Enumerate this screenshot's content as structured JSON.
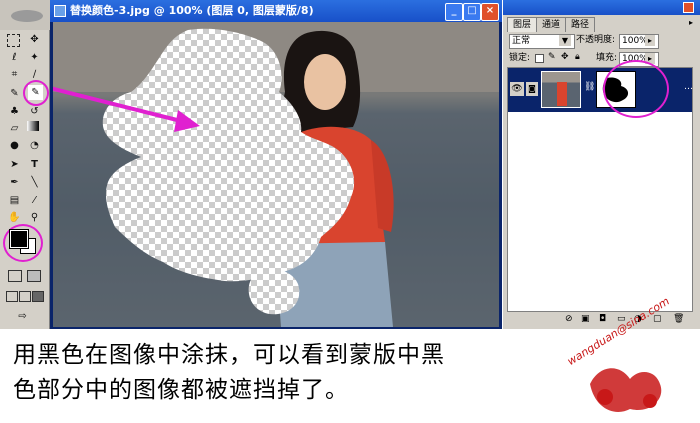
{
  "document": {
    "title": "替换颜色-3.jpg @ 100% (图层 0, 图层蒙版/8)",
    "buttons": {
      "minimize": "_",
      "maximize": "□",
      "close": "×"
    }
  },
  "layers_panel": {
    "tabs": [
      "图层",
      "通道",
      "路径"
    ],
    "blend_mode": "正常",
    "opacity_label": "不透明度:",
    "opacity_value": "100%",
    "lock_label": "锁定:",
    "fill_label": "填充:",
    "fill_value": "100%"
  },
  "caption": {
    "line1": "用黑色在图像中涂抹，可以看到蒙版中黑",
    "line2": "色部分中的图像都被遮挡掉了。"
  },
  "watermark": "wangduan@sina.com",
  "colors": {
    "highlight": "#e020d0",
    "titlebar": "#1850c8",
    "panel": "#d4d0c8"
  },
  "icons": {
    "tools": [
      "marquee",
      "move",
      "lasso",
      "magic-wand",
      "crop",
      "slice",
      "healing",
      "brush",
      "stamp",
      "history-brush",
      "eraser",
      "gradient",
      "blur",
      "dodge",
      "path-select",
      "type",
      "pen",
      "shape",
      "notes",
      "eyedropper",
      "hand",
      "zoom"
    ],
    "layer_footer": [
      "link",
      "style",
      "mask",
      "set",
      "adjust",
      "new",
      "trash"
    ]
  }
}
